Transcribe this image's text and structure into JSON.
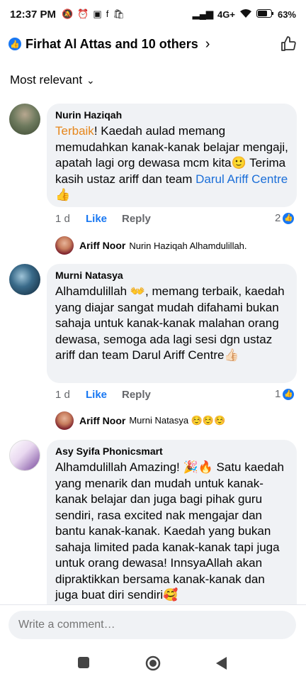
{
  "status": {
    "time": "12:37 PM",
    "network": "4G+",
    "battery": "63%"
  },
  "header": {
    "title": "Firhat Al Attas and 10 others"
  },
  "sort": {
    "label": "Most relevant"
  },
  "comments": [
    {
      "author": "Nurin Haziqah",
      "highlight": "Terbaik",
      "text": "! Kaedah aulad memang memudahkan kanak-kanak belajar mengaji, apatah lagi org dewasa mcm kita🙂 Terima kasih ustaz ariff dan team ",
      "link": "Darul Ariff Centre",
      "tail": " 👍",
      "time": "1 d",
      "like": "Like",
      "reply": "Reply",
      "reactions": "2",
      "reply_author": "Ariff Noor",
      "reply_text": "Nurin Haziqah Alhamdulillah."
    },
    {
      "author": "Murni Natasya",
      "text": "Alhamdulillah 👐, memang terbaik, kaedah yang diajar sangat mudah difahami bukan sahaja untuk kanak-kanak malahan orang dewasa, semoga ada lagi sesi dgn ustaz ariff dan team Darul Ariff Centre👍🏻",
      "time": "1 d",
      "like": "Like",
      "reply": "Reply",
      "reactions": "1",
      "reply_author": "Ariff Noor",
      "reply_text": "Murni Natasya ☺️☺️☺️"
    },
    {
      "author": "Asy Syifa Phonicsmart",
      "text": "Alhamdulillah Amazing! 🎉🔥 Satu kaedah yang menarik dan mudah untuk kanak-kanak belajar dan juga bagi pihak guru sendiri, rasa excited nak mengajar dan bantu kanak-kanak. Kaedah yang bukan sahaja limited pada kanak-kanak tapi juga untuk orang dewasa! InnsyaAllah akan dipraktikkan bersama kanak-kanak dan juga buat diri sendiri🥰"
    }
  ],
  "composer": {
    "placeholder": "Write a comment…"
  },
  "colors": {
    "accent": "#1877f2",
    "bubble": "#f0f2f5",
    "highlight": "#e6861a"
  }
}
